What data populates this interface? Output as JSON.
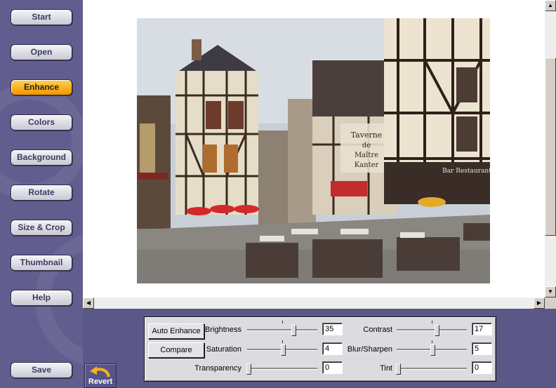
{
  "sidebar": {
    "items": [
      {
        "label": "Start"
      },
      {
        "label": "Open"
      },
      {
        "label": "Enhance"
      },
      {
        "label": "Colors"
      },
      {
        "label": "Background"
      },
      {
        "label": "Rotate"
      },
      {
        "label": "Size & Crop"
      },
      {
        "label": "Thumbnail"
      },
      {
        "label": "Help"
      }
    ],
    "active": "Enhance",
    "save_label": "Save",
    "revert_label": "Revert"
  },
  "photo": {
    "signs": {
      "taverne": "Taverne de Maître Kanter",
      "restaurant": "Bar Restaurant"
    }
  },
  "controls": {
    "auto_enhance_label": "Auto Enhance",
    "compare_label": "Compare",
    "brightness": {
      "label": "Brightness",
      "value": "35"
    },
    "saturation": {
      "label": "Saturation",
      "value": "4"
    },
    "transparency": {
      "label": "Transparency",
      "value": "0"
    },
    "contrast": {
      "label": "Contrast",
      "value": "17"
    },
    "blur_sharpen": {
      "label": "Blur/Sharpen",
      "value": "5"
    },
    "tint": {
      "label": "Tint",
      "value": "0"
    }
  },
  "colors": {
    "active_button": "#f9a21a",
    "sidebar": "#615d8e"
  }
}
